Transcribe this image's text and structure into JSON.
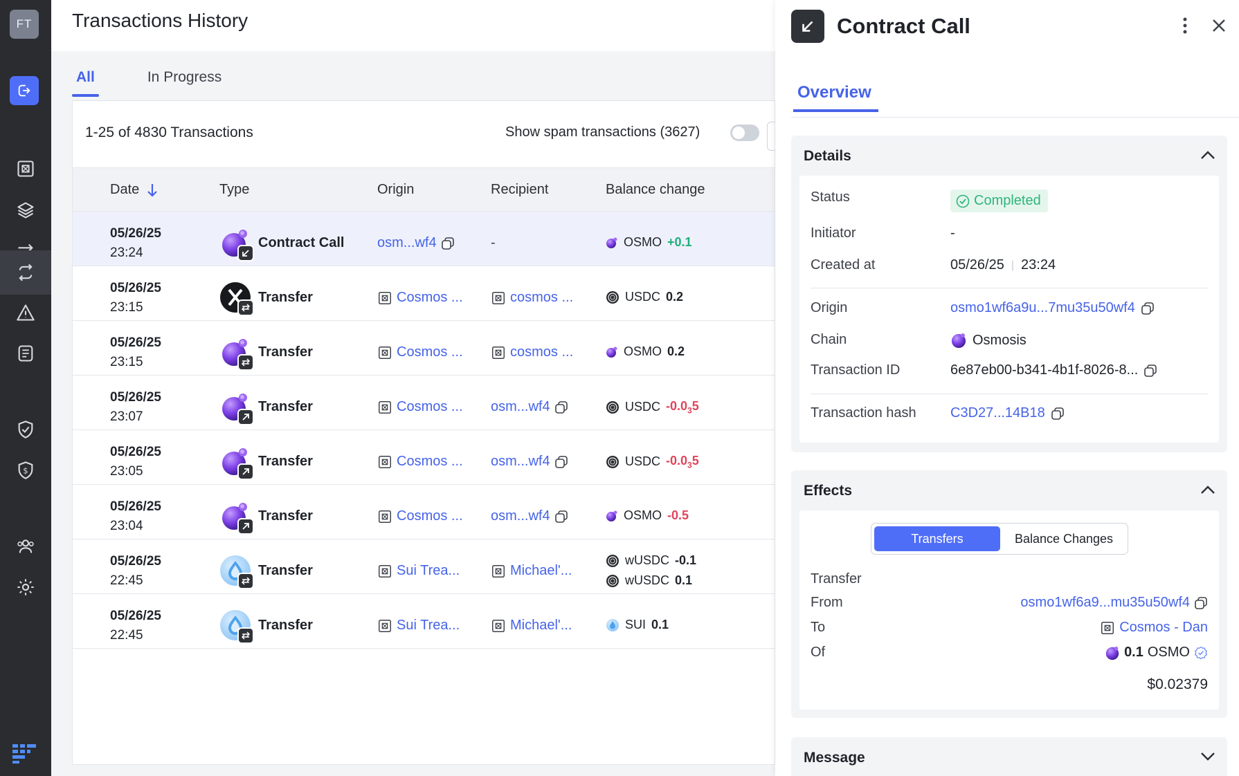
{
  "rail": {
    "avatar": "FT",
    "items": [
      {
        "name": "vault-icon",
        "active": false
      },
      {
        "name": "layers-icon",
        "active": false
      },
      {
        "name": "swap-icon",
        "active": false
      },
      {
        "name": "transactions-icon",
        "active": true
      },
      {
        "name": "alert-icon",
        "active": false
      },
      {
        "name": "clipboard-icon",
        "active": false
      },
      {
        "name": "shield-check-icon",
        "active": false
      },
      {
        "name": "shield-dollar-icon",
        "active": false
      },
      {
        "name": "users-icon",
        "active": false
      },
      {
        "name": "gear-icon",
        "active": false
      }
    ]
  },
  "page": {
    "title": "Transactions History",
    "tabs": [
      "All",
      "In Progress"
    ],
    "count_text": "1-25 of 4830 Transactions",
    "spam_label": "Show spam transactions (3627)"
  },
  "table": {
    "columns": [
      "Date",
      "Type",
      "Origin",
      "Recipient",
      "Balance change"
    ],
    "rows": [
      {
        "date": "05/26/25",
        "time": "23:24",
        "type": "Contract Call",
        "icon": "osmo",
        "badge": "arrow-down-left",
        "origin": "osm...wf4",
        "origin_kind": "address",
        "recipient": "-",
        "recipient_kind": "none",
        "balances": [
          {
            "token": "OSMO",
            "icon": "osmo",
            "amount": "+0.1",
            "dir": "pos"
          }
        ],
        "selected": true
      },
      {
        "date": "05/26/25",
        "time": "23:15",
        "type": "Transfer",
        "icon": "x",
        "badge": "swap",
        "origin": "Cosmos ...",
        "origin_kind": "vault",
        "recipient": "cosmos ...",
        "recipient_kind": "vault",
        "balances": [
          {
            "token": "USDC",
            "icon": "usdc",
            "amount": "0.2",
            "dir": "neu"
          }
        ]
      },
      {
        "date": "05/26/25",
        "time": "23:15",
        "type": "Transfer",
        "icon": "osmo",
        "badge": "swap",
        "origin": "Cosmos ...",
        "origin_kind": "vault",
        "recipient": "cosmos ...",
        "recipient_kind": "vault",
        "balances": [
          {
            "token": "OSMO",
            "icon": "osmo",
            "amount": "0.2",
            "dir": "neu"
          }
        ]
      },
      {
        "date": "05/26/25",
        "time": "23:07",
        "type": "Transfer",
        "icon": "osmo",
        "badge": "arrow-up-right",
        "origin": "Cosmos ...",
        "origin_kind": "vault",
        "recipient": "osm...wf4",
        "recipient_kind": "address",
        "balances": [
          {
            "token": "USDC",
            "icon": "usdc",
            "amount": "-0.0",
            "sub": "3",
            "amount_tail": "5",
            "dir": "neg"
          }
        ]
      },
      {
        "date": "05/26/25",
        "time": "23:05",
        "type": "Transfer",
        "icon": "osmo",
        "badge": "arrow-up-right",
        "origin": "Cosmos ...",
        "origin_kind": "vault",
        "recipient": "osm...wf4",
        "recipient_kind": "address",
        "balances": [
          {
            "token": "USDC",
            "icon": "usdc",
            "amount": "-0.0",
            "sub": "3",
            "amount_tail": "5",
            "dir": "neg"
          }
        ]
      },
      {
        "date": "05/26/25",
        "time": "23:04",
        "type": "Transfer",
        "icon": "osmo",
        "badge": "arrow-up-right",
        "origin": "Cosmos ...",
        "origin_kind": "vault",
        "recipient": "osm...wf4",
        "recipient_kind": "address",
        "balances": [
          {
            "token": "OSMO",
            "icon": "osmo",
            "amount": "-0.5",
            "dir": "neg"
          }
        ]
      },
      {
        "date": "05/26/25",
        "time": "22:45",
        "type": "Transfer",
        "icon": "sui",
        "badge": "swap",
        "origin": "Sui Trea...",
        "origin_kind": "vault",
        "recipient": "Michael'...",
        "recipient_kind": "vault",
        "balances": [
          {
            "token": "wUSDC",
            "icon": "usdc",
            "amount": "-0.1",
            "dir": "neu"
          },
          {
            "token": "wUSDC",
            "icon": "usdc",
            "amount": "0.1",
            "dir": "neu"
          }
        ]
      },
      {
        "date": "05/26/25",
        "time": "22:45",
        "type": "Transfer",
        "icon": "sui",
        "badge": "swap",
        "origin": "Sui Trea...",
        "origin_kind": "vault",
        "recipient": "Michael'...",
        "recipient_kind": "vault",
        "balances": [
          {
            "token": "SUI",
            "icon": "sui",
            "amount": "0.1",
            "dir": "neu"
          }
        ]
      }
    ]
  },
  "panel": {
    "title": "Contract Call",
    "tab": "Overview",
    "details": {
      "heading": "Details",
      "status_label": "Status",
      "status_value": "Completed",
      "initiator_label": "Initiator",
      "initiator_value": "-",
      "created_label": "Created at",
      "created_date": "05/26/25",
      "created_time": "23:24",
      "origin_label": "Origin",
      "origin_value": "osmo1wf6a9u...7mu35u50wf4",
      "chain_label": "Chain",
      "chain_value": "Osmosis",
      "txid_label": "Transaction ID",
      "txid_value": "6e87eb00-b341-4b1f-8026-8...",
      "hash_label": "Transaction hash",
      "hash_value": "C3D27...14B18"
    },
    "effects": {
      "heading": "Effects",
      "seg_a": "Transfers",
      "seg_b": "Balance Changes",
      "transfer_label": "Transfer",
      "from_label": "From",
      "from_value": "osmo1wf6a9...mu35u50wf4",
      "to_label": "To",
      "to_value": "Cosmos - Dan",
      "of_label": "Of",
      "of_amount": "0.1",
      "of_token": "OSMO",
      "usd_value": "$0.02379"
    },
    "message": {
      "heading": "Message"
    }
  },
  "colors": {
    "accent": "#4663e8",
    "positive": "#1fae7a",
    "negative": "#e0445a",
    "rail": "#2a2c30"
  }
}
